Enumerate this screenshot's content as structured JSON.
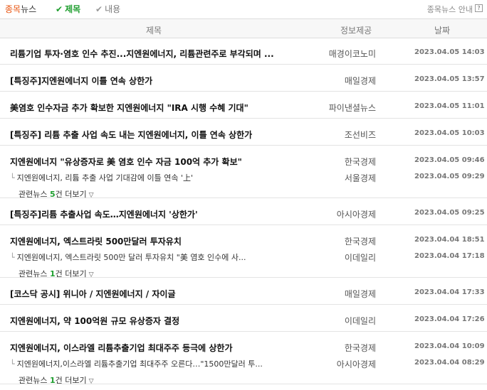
{
  "header": {
    "title_a": "종목",
    "title_b": "뉴스",
    "filter_title": "제목",
    "filter_content": "내용",
    "guide": "종목뉴스 안내",
    "help": "?"
  },
  "columns": {
    "title": "제목",
    "source": "정보제공",
    "date": "날짜"
  },
  "news": [
    {
      "title": "리튬기업 투자·염호 인수 추진...지엔원에너지, 리튬관련주로 부각되며 ...",
      "source": "매경이코노미",
      "date": "2023.04.05 14:03"
    },
    {
      "title": "[특징주]지엔원에너지 이틀 연속 상한가",
      "source": "매일경제",
      "date": "2023.04.05 13:57"
    },
    {
      "title": "美염호 인수자금 추가 확보한 지엔원에너지 \"IRA 시행 수혜 기대\"",
      "source": "파이낸셜뉴스",
      "date": "2023.04.05 11:01"
    },
    {
      "title": "[특징주] 리튬 추출 사업 속도 내는 지엔원에너지, 이틀 연속 상한가",
      "source": "조선비즈",
      "date": "2023.04.05 10:03"
    },
    {
      "title": "지엔원에너지 \"유상증자로 美 염호 인수 자금 100억 추가 확보\"",
      "source": "한국경제",
      "date": "2023.04.05 09:46",
      "sub": {
        "title": "지엔원에너지, 리튬 추출 사업 기대감에 이틀 연속 '上'",
        "source": "서울경제",
        "date": "2023.04.05 09:29"
      },
      "related": {
        "prefix": "관련뉴스 ",
        "count": "5",
        "suffix": "건 더보기"
      }
    },
    {
      "title": "[특징주]리튬 추출사업 속도…지엔원에너지 '상한가'",
      "source": "아시아경제",
      "date": "2023.04.05 09:25"
    },
    {
      "title": "지엔원에너지, 엑스트라릿 500만달러 투자유치",
      "source": "한국경제",
      "date": "2023.04.04 18:51",
      "sub": {
        "title": "지엔원에너지, 엑스트라릿 500만 달러 투자유치 \"美 염호 인수에 사...",
        "source": "이데일리",
        "date": "2023.04.04 17:18"
      },
      "related": {
        "prefix": "관련뉴스 ",
        "count": "1",
        "suffix": "건 더보기"
      }
    },
    {
      "title": "[코스닥 공시] 위니아 / 지엔원에너지 / 자이글",
      "source": "매일경제",
      "date": "2023.04.04 17:33"
    },
    {
      "title": "지엔원에너지, 약 100억원 규모 유상증자 결정",
      "source": "이데일리",
      "date": "2023.04.04 17:26"
    },
    {
      "title": "지엔원에너지, 이스라엘 리튬추출기업 최대주주 등극에 상한가",
      "source": "한국경제",
      "date": "2023.04.04 10:09",
      "sub": {
        "title": "지엔원에너지,이스라엘 리튬추출기업 최대주주 오른다…\"1500만달러 투...",
        "source": "아시아경제",
        "date": "2023.04.04 08:29"
      },
      "related": {
        "prefix": "관련뉴스 ",
        "count": "1",
        "suffix": "건 더보기"
      }
    }
  ]
}
